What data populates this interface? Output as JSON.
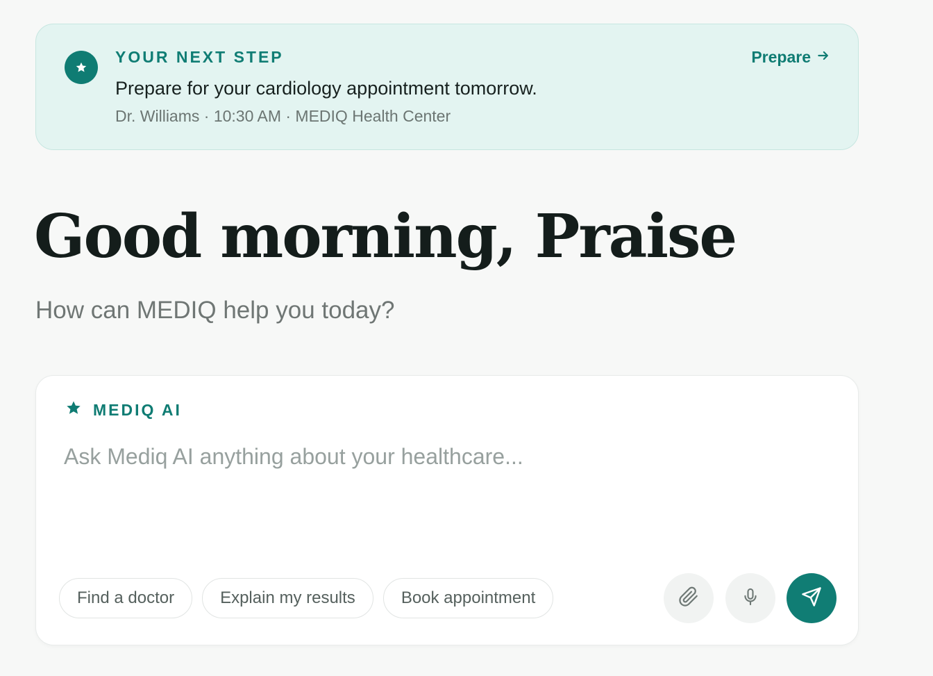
{
  "next_step": {
    "eyebrow": "YOUR NEXT STEP",
    "headline": "Prepare for your cardiology appointment tomorrow.",
    "meta": "Dr. Williams · 10:30 AM · MEDIQ Health Center",
    "action_label": "Prepare",
    "badge_icon": "star-icon",
    "action_icon": "arrow-right-icon"
  },
  "greeting": {
    "title": "Good morning, Praise",
    "subtitle": "How can MEDIQ help you today?"
  },
  "composer": {
    "label": "MEDIQ AI",
    "label_icon": "star-icon",
    "input_value": "",
    "input_placeholder": "Ask Mediq AI anything about your healthcare...",
    "suggestions": [
      "Find a doctor",
      "Explain my results",
      "Book appointment"
    ],
    "actions": {
      "attach_icon": "paperclip-icon",
      "mic_icon": "microphone-icon",
      "send_icon": "send-icon"
    }
  },
  "colors": {
    "accent": "#107d74",
    "card_tint": "#e3f4f1",
    "background": "#f7f8f7"
  }
}
